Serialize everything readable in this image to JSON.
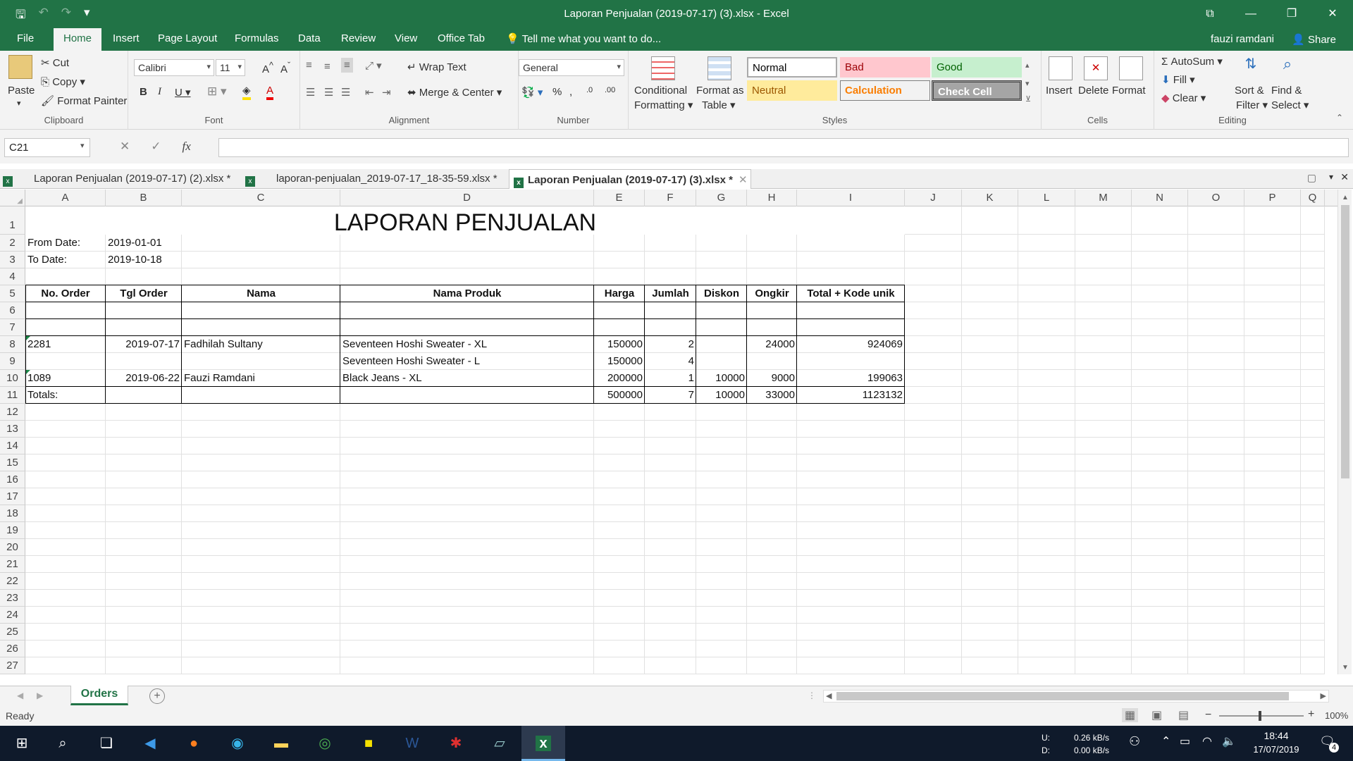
{
  "app": {
    "window_title": "Laporan Penjualan (2019-07-17) (3).xlsx - Excel",
    "user": "fauzi ramdani",
    "share": "Share"
  },
  "tabs": [
    "File",
    "Home",
    "Insert",
    "Page Layout",
    "Formulas",
    "Data",
    "Review",
    "View",
    "Office Tab"
  ],
  "tell_me": "Tell me what you want to do...",
  "clipboard": {
    "paste": "Paste",
    "cut": "Cut",
    "copy": "Copy",
    "format_painter": "Format Painter",
    "label": "Clipboard"
  },
  "font": {
    "name": "Calibri",
    "size": "11",
    "label": "Font"
  },
  "alignment": {
    "wrap": "Wrap Text",
    "merge": "Merge & Center",
    "label": "Alignment"
  },
  "number": {
    "format": "General",
    "label": "Number"
  },
  "styles": {
    "conditional": "Conditional",
    "conditional2": "Formatting",
    "format_as": "Format as",
    "format_as2": "Table",
    "normal": "Normal",
    "bad": "Bad",
    "good": "Good",
    "neutral": "Neutral",
    "calculation": "Calculation",
    "check_cell": "Check Cell",
    "label": "Styles"
  },
  "cells": {
    "insert": "Insert",
    "delete": "Delete",
    "format": "Format",
    "label": "Cells"
  },
  "editing": {
    "autosum": "AutoSum",
    "fill": "Fill",
    "clear": "Clear",
    "sort": "Sort &",
    "sort2": "Filter",
    "find": "Find &",
    "find2": "Select",
    "label": "Editing"
  },
  "formula_bar": {
    "name_box": "C21",
    "value": ""
  },
  "doc_tabs": [
    "Laporan Penjualan (2019-07-17) (2).xlsx *",
    "laporan-penjualan_2019-07-17_18-35-59.xlsx *",
    "Laporan Penjualan (2019-07-17) (3).xlsx *"
  ],
  "columns": [
    "A",
    "B",
    "C",
    "D",
    "E",
    "F",
    "G",
    "H",
    "I",
    "J",
    "K",
    "L",
    "M",
    "N",
    "O",
    "P",
    "Q"
  ],
  "rows": [
    "1",
    "2",
    "3",
    "4",
    "5",
    "6",
    "7",
    "8",
    "9",
    "10",
    "11",
    "12",
    "13",
    "14",
    "15",
    "16",
    "17",
    "18",
    "19",
    "20",
    "21",
    "22",
    "23",
    "24",
    "25",
    "26",
    "27"
  ],
  "sheet": {
    "title": "LAPORAN PENJUALAN",
    "from_label": "From Date:",
    "from_value": "2019-01-01",
    "to_label": "To Date:",
    "to_value": "2019-10-18",
    "headers": [
      "No. Order",
      "Tgl Order",
      "Nama",
      "Nama Produk",
      "Harga",
      "Jumlah",
      "Diskon",
      "Ongkir",
      "Total + Kode unik"
    ],
    "data": [
      [
        "2281",
        "2019-07-17",
        "Fadhilah Sultany",
        "Seventeen Hoshi Sweater - XL",
        "150000",
        "2",
        "",
        "24000",
        "924069"
      ],
      [
        "",
        "",
        "",
        "Seventeen Hoshi Sweater - L",
        "150000",
        "4",
        "",
        "",
        ""
      ],
      [
        "1089",
        "2019-06-22",
        "Fauzi Ramdani",
        "Black Jeans - XL",
        "200000",
        "1",
        "10000",
        "9000",
        "199063"
      ],
      [
        "Totals:",
        "",
        "",
        "",
        "500000",
        "7",
        "10000",
        "33000",
        "1123132"
      ]
    ]
  },
  "sheet_tab": "Orders",
  "status": {
    "ready": "Ready",
    "zoom": "100%"
  },
  "taskbar": {
    "up_label": "U:",
    "down_label": "D:",
    "up": "0.26 kB/s",
    "down": "0.00 kB/s",
    "time": "18:44",
    "date": "17/07/2019",
    "notif": "4"
  }
}
